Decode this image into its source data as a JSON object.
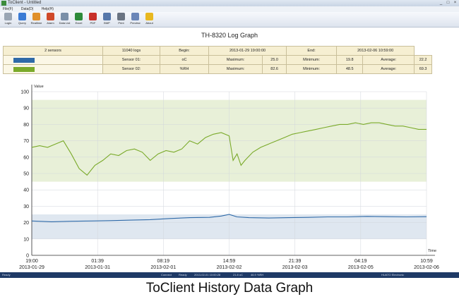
{
  "window": {
    "title": "ToClient - Untitled",
    "minimize": "_",
    "maximize": "□",
    "close": "×"
  },
  "menu": [
    "File(F)",
    "Data(D)",
    "Help(H)"
  ],
  "toolbar": [
    {
      "label": "Login",
      "icon": "login-icon",
      "color": "#9aa6b4"
    },
    {
      "label": "Query",
      "icon": "query-icon",
      "color": "#3a7bd5"
    },
    {
      "label": "Realtime",
      "icon": "realtime-icon",
      "color": "#e0902a"
    },
    {
      "label": "Alarm",
      "icon": "alarm-icon",
      "color": "#d04a2a"
    },
    {
      "label": "Data List",
      "icon": "data-list-icon",
      "color": "#7a8fa8"
    },
    {
      "label": "Excel",
      "icon": "excel-icon",
      "color": "#2e8b3a"
    },
    {
      "label": "PDF",
      "icon": "pdf-icon",
      "color": "#c8302a"
    },
    {
      "label": "BMP",
      "icon": "bmp-icon",
      "color": "#5577aa"
    },
    {
      "label": "Print",
      "icon": "print-icon",
      "color": "#6a7482"
    },
    {
      "label": "Preview",
      "icon": "preview-icon",
      "color": "#6a86b8"
    },
    {
      "label": "About",
      "icon": "about-icon",
      "color": "#e8b820"
    }
  ],
  "graph_title": "TH-8320 Log Graph",
  "info": {
    "sensors": "2 sensors",
    "logs": "11040 logs",
    "begin_label": "Begin:",
    "begin_value": "2013-01-29 19:00:00",
    "end_label": "End:",
    "end_value": "2013-02-06 10:59:00",
    "rows": [
      {
        "color": "#2f6aa8",
        "name": "Sensor 01:",
        "unit": "oC",
        "max_label": "Maximum:",
        "max": "25.0",
        "min_label": "Minimum:",
        "min": "19.8",
        "avg_label": "Average:",
        "avg": "22.2"
      },
      {
        "color": "#7aaa2a",
        "name": "Sensor 02:",
        "unit": "%RH",
        "max_label": "Maximum:",
        "max": "82.6",
        "min_label": "Minimum:",
        "min": "48.5",
        "avg_label": "Average:",
        "avg": "69.3"
      }
    ]
  },
  "chart_data": {
    "type": "line",
    "ylabel": "Value",
    "xlabel": "Time",
    "ylim": [
      0,
      100
    ],
    "yticks": [
      0,
      10,
      20,
      30,
      40,
      50,
      60,
      70,
      80,
      90,
      100
    ],
    "xticks": [
      {
        "pos": 0.0,
        "time": "19:00",
        "date": "2013-01-29"
      },
      {
        "pos": 0.1667,
        "time": "01:39",
        "date": "2013-01-31"
      },
      {
        "pos": 0.3333,
        "time": "08:19",
        "date": "2013-02-01"
      },
      {
        "pos": 0.5,
        "time": "14:59",
        "date": "2013-02-02"
      },
      {
        "pos": 0.6667,
        "time": "21:39",
        "date": "2013-02-03"
      },
      {
        "pos": 0.8333,
        "time": "04:19",
        "date": "2013-02-05"
      },
      {
        "pos": 1.0,
        "time": "10:59",
        "date": "2013-02-06"
      }
    ],
    "bands": [
      {
        "from": 45,
        "to": 95,
        "color": "#e8f0d8"
      },
      {
        "from": 10,
        "to": 25,
        "color": "#dfe7f0"
      }
    ],
    "series": [
      {
        "color": "#7aaa2a",
        "x": [
          0,
          0.02,
          0.04,
          0.06,
          0.08,
          0.1,
          0.12,
          0.14,
          0.16,
          0.18,
          0.2,
          0.22,
          0.24,
          0.26,
          0.28,
          0.3,
          0.32,
          0.34,
          0.36,
          0.38,
          0.4,
          0.42,
          0.44,
          0.46,
          0.48,
          0.5,
          0.51,
          0.52,
          0.53,
          0.54,
          0.56,
          0.58,
          0.6,
          0.62,
          0.64,
          0.66,
          0.68,
          0.7,
          0.72,
          0.74,
          0.76,
          0.78,
          0.8,
          0.82,
          0.84,
          0.86,
          0.88,
          0.9,
          0.92,
          0.94,
          0.96,
          0.98,
          1.0
        ],
        "y": [
          66,
          67,
          66,
          68,
          70,
          62,
          53,
          49,
          55,
          58,
          62,
          61,
          64,
          65,
          63,
          58,
          62,
          64,
          63,
          65,
          70,
          68,
          72,
          74,
          75,
          73,
          58,
          62,
          55,
          58,
          63,
          66,
          68,
          70,
          72,
          74,
          75,
          76,
          77,
          78,
          79,
          80,
          80,
          81,
          80,
          81,
          81,
          80,
          79,
          79,
          78,
          77,
          77
        ]
      },
      {
        "color": "#2f6aa8",
        "x": [
          0,
          0.05,
          0.1,
          0.15,
          0.2,
          0.25,
          0.3,
          0.35,
          0.4,
          0.45,
          0.48,
          0.5,
          0.52,
          0.55,
          0.6,
          0.65,
          0.7,
          0.75,
          0.8,
          0.85,
          0.9,
          0.95,
          1.0
        ],
        "y": [
          21,
          20.5,
          20.8,
          21,
          21.2,
          21.5,
          21.8,
          22.5,
          23,
          23.2,
          24,
          25,
          23.5,
          23,
          22.8,
          23,
          23.2,
          23.5,
          23.5,
          23.8,
          23.6,
          23.5,
          23.6
        ]
      }
    ]
  },
  "status": {
    "ready": "Ready",
    "connect": "Connect",
    "state": "Ready",
    "time": "2013-02-01 10:00:28",
    "temp": "21.8 oC",
    "hum": "46.9 %RH",
    "company": "HUATO Electronic"
  },
  "caption": "ToClient History Data Graph"
}
